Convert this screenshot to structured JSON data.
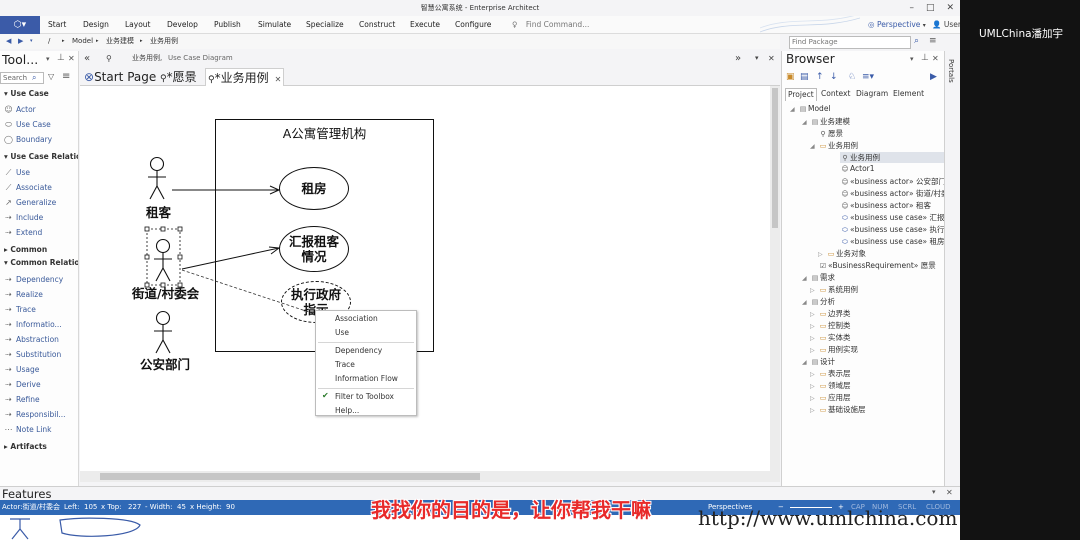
{
  "titlebar": {
    "title": "智慧公寓系统 - Enterprise Architect"
  },
  "ribbon": {
    "menu": [
      "Start",
      "Design",
      "Layout",
      "Develop",
      "Publish",
      "Simulate",
      "Specialize",
      "Construct",
      "Execute",
      "Configure"
    ],
    "find_command": "Find Command...",
    "perspective": "Perspective",
    "user": "User"
  },
  "breadcrumb": {
    "root": "/",
    "items": [
      "Model",
      "业务建模",
      "业务用例"
    ]
  },
  "diagram_header": {
    "name": "业务用例,",
    "type": "Use Case Diagram"
  },
  "toolbox": {
    "title": "Tool...",
    "search_placeholder": "Search",
    "groups": {
      "use_case": "Use Case",
      "use_case_relations": "Use Case Relations",
      "common": "Common",
      "common_relations": "Common Relations",
      "artifacts": "Artifacts"
    },
    "use_case_items": [
      "Actor",
      "Use Case",
      "Boundary"
    ],
    "use_case_relation_items": [
      "Use",
      "Associate",
      "Generalize",
      "Include",
      "Extend"
    ],
    "common_relation_items": [
      "Dependency",
      "Realize",
      "Trace",
      "Informatio...",
      "Abstraction",
      "Substitution",
      "Usage",
      "Derive",
      "Refine",
      "Responsibil...",
      "Note Link"
    ]
  },
  "tabs": [
    "Start Page",
    "*愿景",
    "*业务用例"
  ],
  "diagram": {
    "boundary": "A公寓管理机构",
    "actors": [
      "租客",
      "街道/村委会",
      "公安部门"
    ],
    "usecases": [
      "租房",
      "汇报租客情况",
      "执行政府指示"
    ]
  },
  "context_menu": {
    "items": [
      "Association",
      "Use",
      "Dependency",
      "Trace",
      "Information Flow",
      "Filter to Toolbox",
      "Help..."
    ]
  },
  "browser": {
    "title": "Browser",
    "find_placeholder": "Find Package",
    "tabs": [
      "Project",
      "Context",
      "Diagram",
      "Element"
    ],
    "tree": [
      "Model",
      "业务建模",
      "愿景",
      "业务用例",
      "业务用例",
      "Actor1",
      "«business actor» 公安部门",
      "«business actor» 街道/村委会",
      "«business actor» 租客",
      "«business use case» 汇报租客情况",
      "«business use case» 执行政府指示",
      "«business use case» 租房",
      "业务对象",
      "«BusinessRequirement» 愿景",
      "需求",
      "系统用例",
      "分析",
      "边界类",
      "控制类",
      "实体类",
      "用例实现",
      "设计",
      "表示层",
      "领域层",
      "应用层",
      "基础设施层"
    ]
  },
  "portals": "Portals",
  "features": "Features",
  "status": {
    "element": "Actor:街道/村委会",
    "left": "Left:",
    "left_val": "105",
    "top": "x Top:",
    "top_val": "227",
    "width": "- Width:",
    "width_val": "45",
    "height": "x Height:",
    "height_val": "90",
    "perspectives": "Perspectives",
    "flags": [
      "CAP",
      "NUM",
      "SCRL",
      "CLOUD"
    ]
  },
  "brand": "UMLChina潘加宇",
  "subtitle": "我找你的目的是，让你帮我干嘛",
  "watermark": "http://www.umlchina.com",
  "colors": {
    "app_accent": "#3b5ba8",
    "status_bar": "#2f69b6",
    "subtitle": "#e82a2a"
  }
}
